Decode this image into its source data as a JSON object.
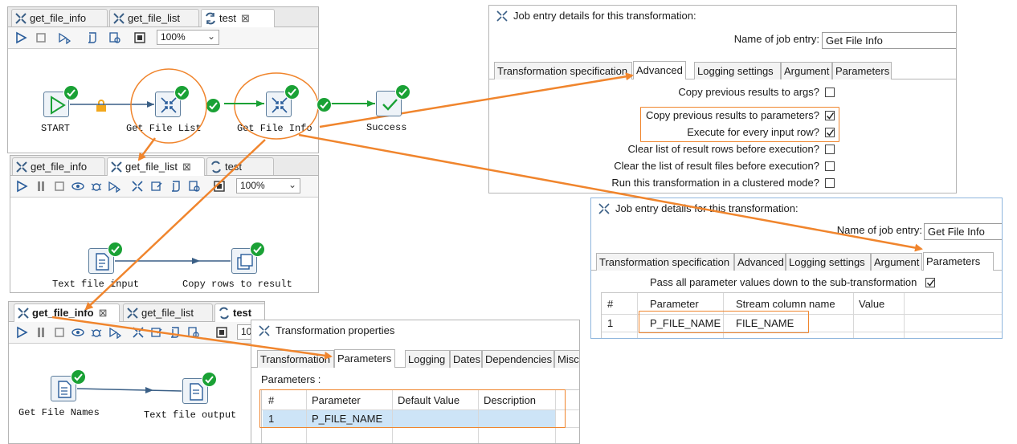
{
  "job_panel": {
    "tabs": [
      "get_file_info",
      "get_file_list",
      "test"
    ],
    "zoom": "100%",
    "nodes": [
      "START",
      "Get File List",
      "Get File Info",
      "Success"
    ]
  },
  "list_panel": {
    "tabs": [
      "get_file_info",
      "get_file_list",
      "test"
    ],
    "zoom": "100%",
    "nodes": [
      "Text file input",
      "Copy rows to result"
    ]
  },
  "info_panel": {
    "tabs": [
      "get_file_info",
      "get_file_list",
      "test"
    ],
    "zoom": "10",
    "nodes": [
      "Get File Names",
      "Text file output"
    ]
  },
  "advanced_dialog": {
    "title": "Job entry details for this transformation:",
    "name_label": "Name of job entry:",
    "name_value": "Get File Info",
    "tabs": [
      "Transformation specification",
      "Advanced",
      "Logging settings",
      "Argument",
      "Parameters"
    ],
    "options": [
      {
        "label": "Copy previous results to args?",
        "checked": false
      },
      {
        "label": "Copy previous results to parameters?",
        "checked": true
      },
      {
        "label": "Execute for every input row?",
        "checked": true
      },
      {
        "label": "Clear list of result rows before execution?",
        "checked": false
      },
      {
        "label": "Clear the list of result files before execution?",
        "checked": false
      },
      {
        "label": "Run this transformation in a clustered mode?",
        "checked": false
      }
    ]
  },
  "params_dialog": {
    "title": "Job entry details for this transformation:",
    "name_label": "Name of job entry:",
    "name_value": "Get File Info",
    "tabs": [
      "Transformation specification",
      "Advanced",
      "Logging settings",
      "Argument",
      "Parameters"
    ],
    "pass_all_label": "Pass all parameter values down to the sub-transformation",
    "pass_all_checked": true,
    "columns": [
      "#",
      "Parameter",
      "Stream column name",
      "Value"
    ],
    "rows": [
      [
        "1",
        "P_FILE_NAME",
        "FILE_NAME",
        ""
      ]
    ]
  },
  "trans_dialog": {
    "title": "Transformation properties",
    "tabs": [
      "Transformation",
      "Parameters",
      "Logging",
      "Dates",
      "Dependencies",
      "Misc"
    ],
    "section_label": "Parameters :",
    "columns": [
      "#",
      "Parameter",
      "Default Value",
      "Description"
    ],
    "rows": [
      [
        "1",
        "P_FILE_NAME",
        "",
        ""
      ]
    ]
  },
  "colors": {
    "accent": "#f0852d",
    "ok": "#1aa135",
    "hop": "#1aa135",
    "selection": "#cde4f7"
  }
}
